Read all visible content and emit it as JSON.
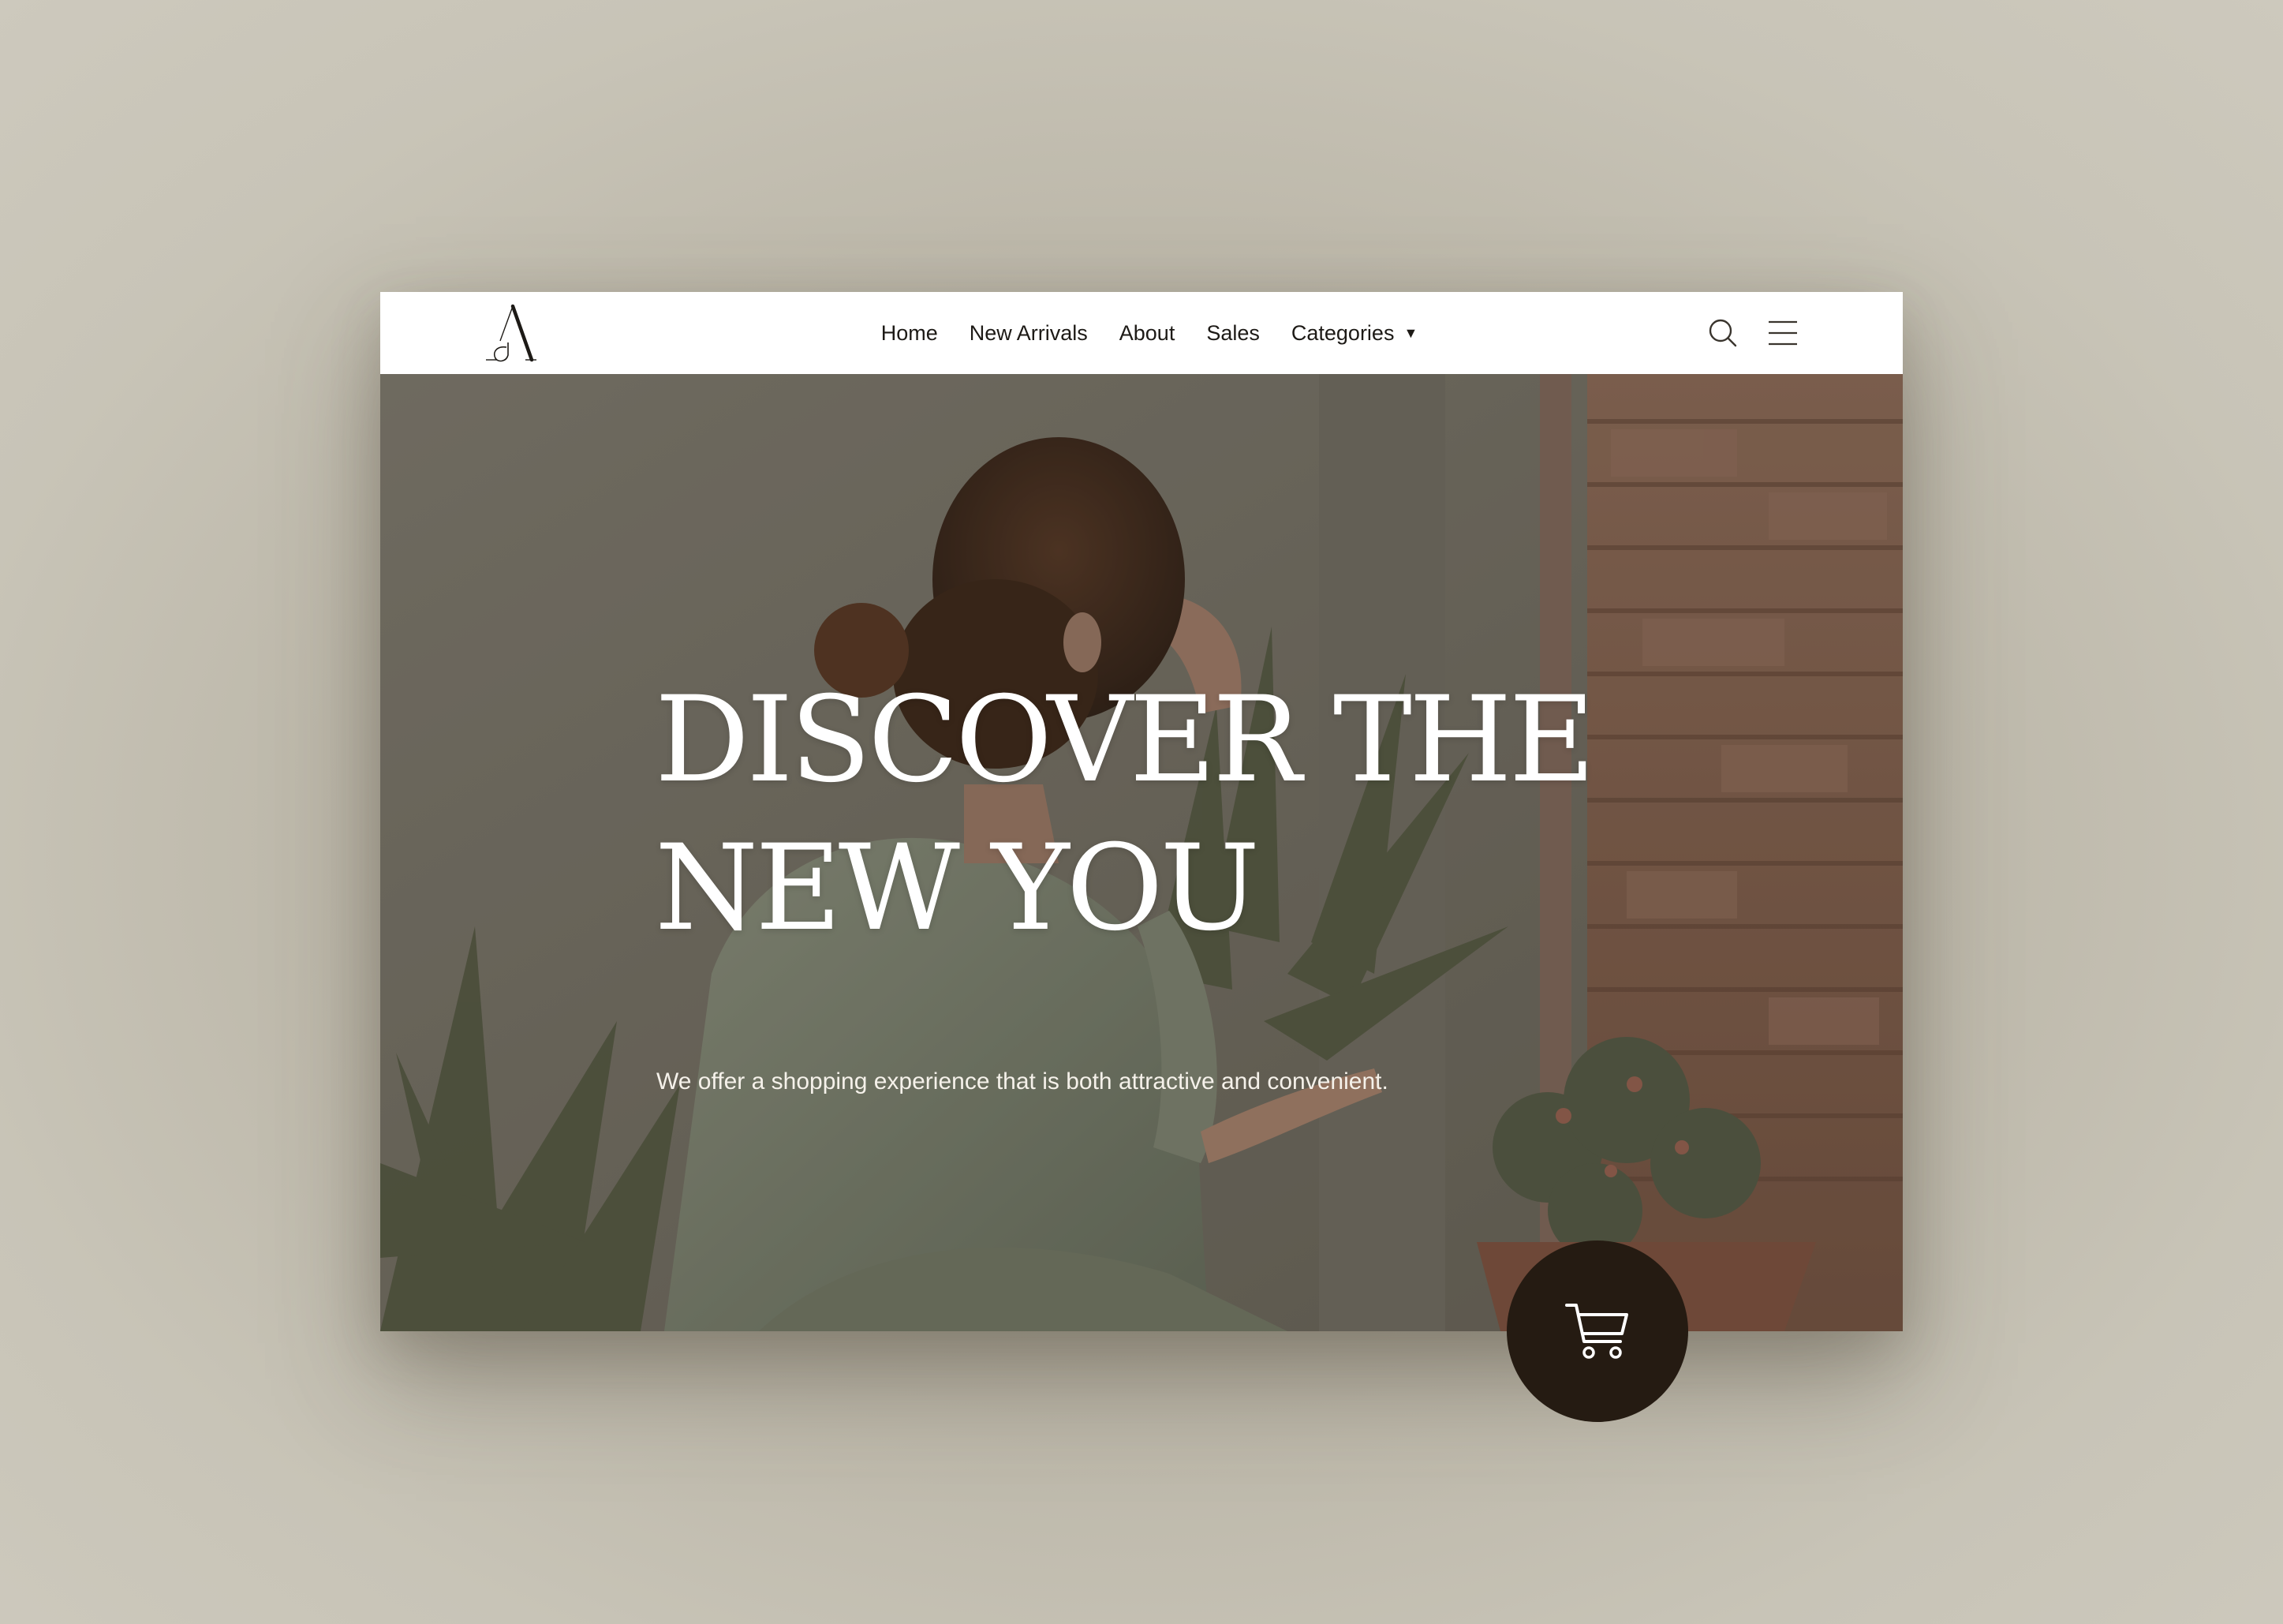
{
  "brand": {
    "logo_letter": "A",
    "logo_icon": "brand-monogram-icon"
  },
  "nav": {
    "items": [
      {
        "label": "Home"
      },
      {
        "label": "New Arrivals"
      },
      {
        "label": "About"
      },
      {
        "label": "Sales"
      },
      {
        "label": "Categories",
        "has_dropdown": true,
        "dropdown_glyph": "▼"
      }
    ],
    "search_icon": "search-icon",
    "menu_icon": "hamburger-menu-icon"
  },
  "hero": {
    "title_line1": "DISCOVER THE",
    "title_line2": "NEW YOU",
    "subtitle": "We offer a shopping experience that is both attractive and convenient.",
    "image_icon": "hero-photo-woman-among-plants"
  },
  "cart": {
    "icon": "shopping-cart-icon"
  },
  "colors": {
    "background": "#c8c4b7",
    "navbar": "#ffffff",
    "text_dark": "#1d1a16",
    "cart_button": "#251b12",
    "hero_text": "#ffffff"
  }
}
